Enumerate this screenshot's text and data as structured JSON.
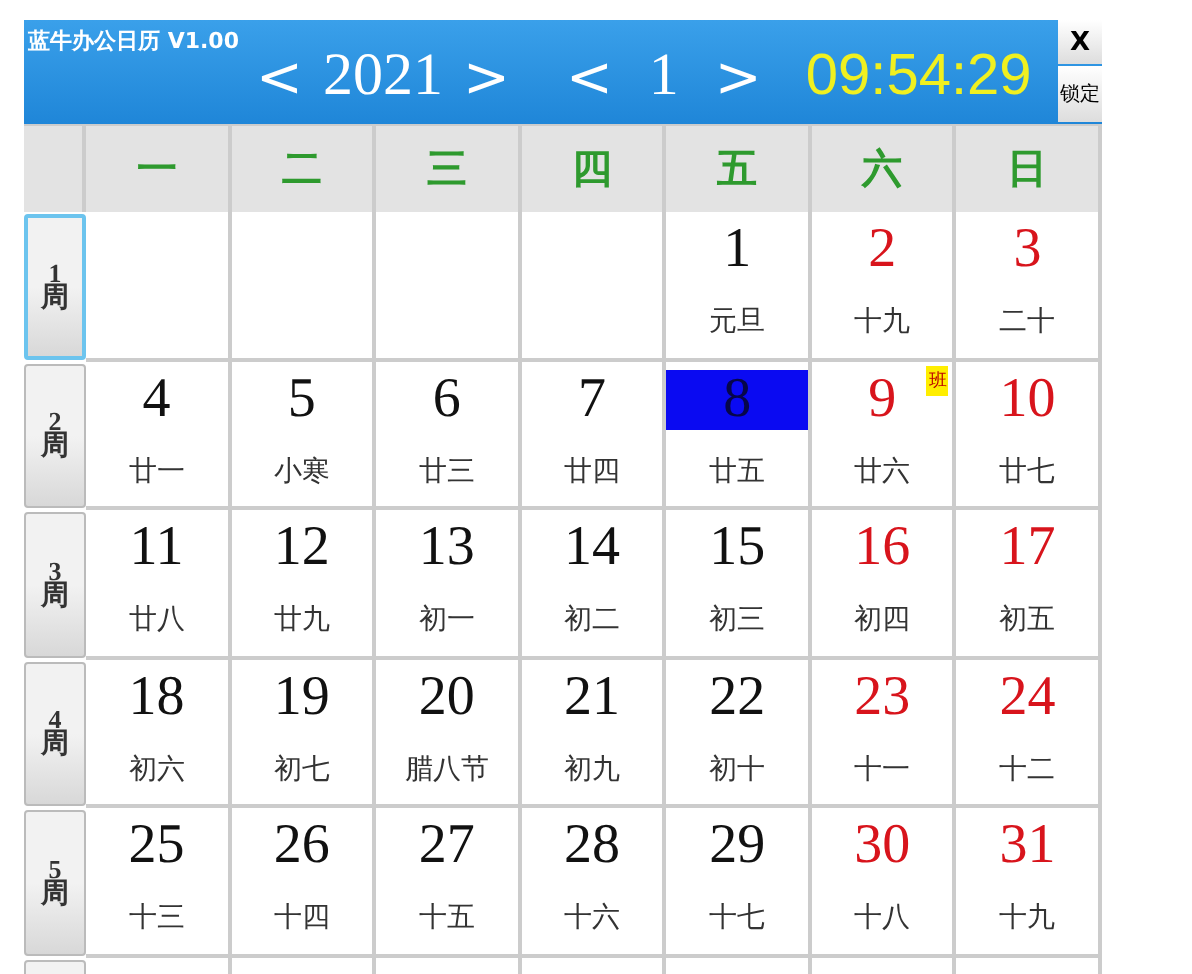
{
  "window": {
    "title": "蓝牛办公日历 V1.00",
    "close": "X",
    "lock": "锁定"
  },
  "nav": {
    "prev_year": "<",
    "year": "2021",
    "next_year": ">",
    "prev_month": "<",
    "month": "1",
    "next_month": ">",
    "time": "09:54:29"
  },
  "weekdays": [
    "一",
    "二",
    "三",
    "四",
    "五",
    "六",
    "日"
  ],
  "weeks": [
    {
      "number": "1",
      "suffix": "周",
      "selected": true,
      "days": [
        {
          "kind": "empty"
        },
        {
          "kind": "empty"
        },
        {
          "kind": "empty"
        },
        {
          "kind": "empty"
        },
        {
          "kind": "day",
          "day": "1",
          "lunar": "元旦",
          "holiday": false,
          "selected": false
        },
        {
          "kind": "day",
          "day": "2",
          "lunar": "十九",
          "holiday": true,
          "selected": false
        },
        {
          "kind": "day",
          "day": "3",
          "lunar": "二十",
          "holiday": true,
          "selected": false
        }
      ]
    },
    {
      "number": "2",
      "suffix": "周",
      "selected": false,
      "days": [
        {
          "kind": "day",
          "day": "4",
          "lunar": "廿一",
          "holiday": false,
          "selected": false
        },
        {
          "kind": "day",
          "day": "5",
          "lunar": "小寒",
          "holiday": false,
          "selected": false
        },
        {
          "kind": "day",
          "day": "6",
          "lunar": "廿三",
          "holiday": false,
          "selected": false
        },
        {
          "kind": "day",
          "day": "7",
          "lunar": "廿四",
          "holiday": false,
          "selected": false
        },
        {
          "kind": "day",
          "day": "8",
          "lunar": "廿五",
          "holiday": false,
          "selected": true
        },
        {
          "kind": "day",
          "day": "9",
          "lunar": "廿六",
          "holiday": true,
          "selected": false,
          "badge": "班"
        },
        {
          "kind": "day",
          "day": "10",
          "lunar": "廿七",
          "holiday": true,
          "selected": false
        }
      ]
    },
    {
      "number": "3",
      "suffix": "周",
      "selected": false,
      "days": [
        {
          "kind": "day",
          "day": "11",
          "lunar": "廿八",
          "holiday": false,
          "selected": false
        },
        {
          "kind": "day",
          "day": "12",
          "lunar": "廿九",
          "holiday": false,
          "selected": false
        },
        {
          "kind": "day",
          "day": "13",
          "lunar": "初一",
          "holiday": false,
          "selected": false
        },
        {
          "kind": "day",
          "day": "14",
          "lunar": "初二",
          "holiday": false,
          "selected": false
        },
        {
          "kind": "day",
          "day": "15",
          "lunar": "初三",
          "holiday": false,
          "selected": false
        },
        {
          "kind": "day",
          "day": "16",
          "lunar": "初四",
          "holiday": true,
          "selected": false
        },
        {
          "kind": "day",
          "day": "17",
          "lunar": "初五",
          "holiday": true,
          "selected": false
        }
      ]
    },
    {
      "number": "4",
      "suffix": "周",
      "selected": false,
      "days": [
        {
          "kind": "day",
          "day": "18",
          "lunar": "初六",
          "holiday": false,
          "selected": false
        },
        {
          "kind": "day",
          "day": "19",
          "lunar": "初七",
          "holiday": false,
          "selected": false
        },
        {
          "kind": "day",
          "day": "20",
          "lunar": "腊八节",
          "holiday": false,
          "selected": false
        },
        {
          "kind": "day",
          "day": "21",
          "lunar": "初九",
          "holiday": false,
          "selected": false
        },
        {
          "kind": "day",
          "day": "22",
          "lunar": "初十",
          "holiday": false,
          "selected": false
        },
        {
          "kind": "day",
          "day": "23",
          "lunar": "十一",
          "holiday": true,
          "selected": false
        },
        {
          "kind": "day",
          "day": "24",
          "lunar": "十二",
          "holiday": true,
          "selected": false
        }
      ]
    },
    {
      "number": "5",
      "suffix": "周",
      "selected": false,
      "days": [
        {
          "kind": "day",
          "day": "25",
          "lunar": "十三",
          "holiday": false,
          "selected": false
        },
        {
          "kind": "day",
          "day": "26",
          "lunar": "十四",
          "holiday": false,
          "selected": false
        },
        {
          "kind": "day",
          "day": "27",
          "lunar": "十五",
          "holiday": false,
          "selected": false
        },
        {
          "kind": "day",
          "day": "28",
          "lunar": "十六",
          "holiday": false,
          "selected": false
        },
        {
          "kind": "day",
          "day": "29",
          "lunar": "十七",
          "holiday": false,
          "selected": false
        },
        {
          "kind": "day",
          "day": "30",
          "lunar": "十八",
          "holiday": true,
          "selected": false
        },
        {
          "kind": "day",
          "day": "31",
          "lunar": "十九",
          "holiday": true,
          "selected": false
        }
      ]
    }
  ]
}
